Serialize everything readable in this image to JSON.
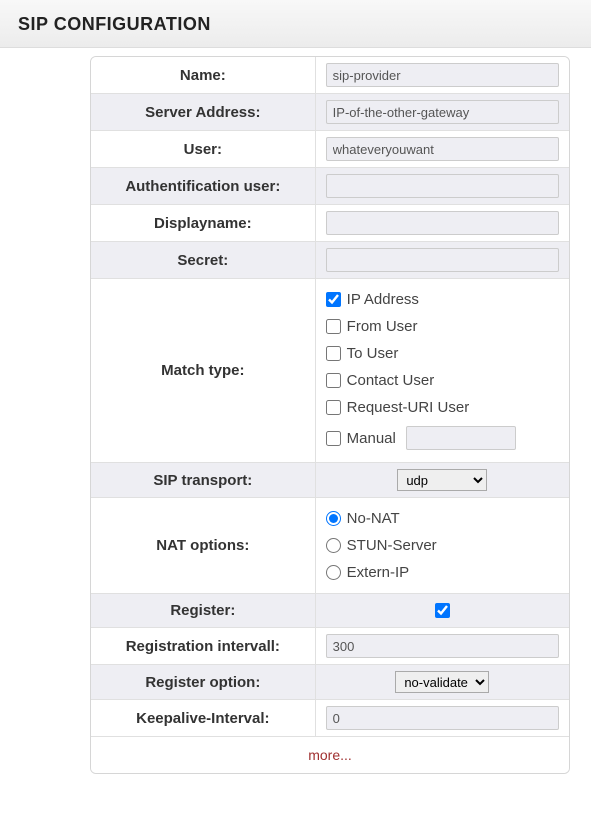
{
  "header": {
    "title": "SIP CONFIGURATION"
  },
  "fields": {
    "name": {
      "label": "Name:",
      "value": "sip-provider"
    },
    "server": {
      "label": "Server Address:",
      "value": "IP-of-the-other-gateway"
    },
    "user": {
      "label": "User:",
      "value": "whateveryouwant"
    },
    "authuser": {
      "label": "Authentification user:",
      "value": ""
    },
    "displayname": {
      "label": "Displayname:",
      "value": ""
    },
    "secret": {
      "label": "Secret:",
      "value": ""
    },
    "matchtype": {
      "label": "Match type:",
      "options": {
        "ip": "IP Address",
        "fromuser": "From User",
        "touser": "To User",
        "contactuser": "Contact User",
        "requri": "Request-URI User",
        "manual": "Manual"
      }
    },
    "siptransport": {
      "label": "SIP transport:",
      "selected": "udp"
    },
    "nat": {
      "label": "NAT options:",
      "options": {
        "nonat": "No-NAT",
        "stun": "STUN-Server",
        "extern": "Extern-IP"
      }
    },
    "register": {
      "label": "Register:"
    },
    "reginterval": {
      "label": "Registration intervall:",
      "value": "300"
    },
    "regoption": {
      "label": "Register option:",
      "selected": "no-validate"
    },
    "keepalive": {
      "label": "Keepalive-Interval:",
      "value": "0"
    }
  },
  "more": "more..."
}
